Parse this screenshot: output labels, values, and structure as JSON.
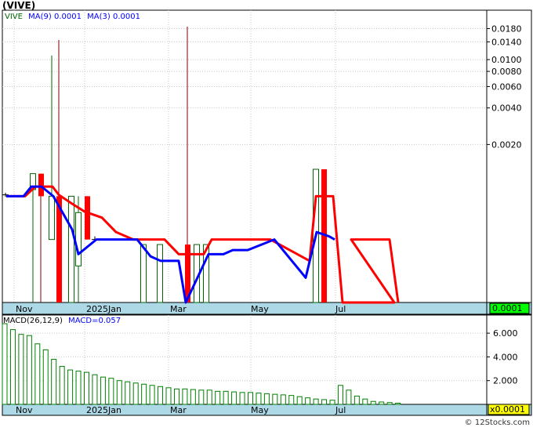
{
  "ticker_label": "(VIVE)",
  "watermark": "© 12Stocks.com",
  "chart_data": [
    {
      "type": "candlestick",
      "name": "price",
      "legend": {
        "symbol": "VIVE",
        "ma9_label": "MA(9)",
        "ma9_value": "0.0001",
        "ma3_label": "MA(3)",
        "ma3_value": "0.0001"
      },
      "scale": "log",
      "ylim": [
        0.0001,
        0.022
      ],
      "y_ticks": [
        "0.0180",
        "0.0140",
        "0.0100",
        "0.0080",
        "0.0060",
        "0.0040",
        "0.0020"
      ],
      "y_tick_values": [
        0.018,
        0.014,
        0.01,
        0.008,
        0.006,
        0.004,
        0.002
      ],
      "x_labels": [
        "Nov",
        "2025Jan",
        "Mar",
        "May",
        "Jul"
      ],
      "last_price_label": "0.0001",
      "colors": {
        "up": "#006400",
        "down": "#ff0000",
        "wick_down": "#800000",
        "ma9": "#0000ff",
        "ma3": "#ff0000",
        "axis_bg": "#add8e6",
        "last_bg": "#00ff00"
      },
      "candles": [
        {
          "x": 7,
          "o": 0.00077,
          "c": 0.00077,
          "h": 0.0008,
          "l": 0.00074,
          "dir": "tick"
        },
        {
          "x": 42,
          "o": 0.00085,
          "c": 0.00115,
          "h": 0.00115,
          "l": 0.0001,
          "dir": "up"
        },
        {
          "x": 52,
          "o": 0.00115,
          "c": 0.00075,
          "h": 0.00115,
          "l": 0.0001,
          "dir": "down"
        },
        {
          "x": 66,
          "o": 0.00033,
          "c": 0.00075,
          "h": 0.0108,
          "l": 0.00033,
          "dir": "up"
        },
        {
          "x": 75,
          "o": 0.00075,
          "c": 0.0001,
          "h": 0.0145,
          "l": 0.0001,
          "dir": "down"
        },
        {
          "x": 91,
          "o": 0.0001,
          "c": 0.00075,
          "h": 0.00075,
          "l": 0.0001,
          "dir": "up"
        },
        {
          "x": 100,
          "o": 0.0002,
          "c": 0.00055,
          "h": 0.00075,
          "l": 0.0001,
          "dir": "up"
        },
        {
          "x": 111,
          "o": 0.00075,
          "c": 0.00033,
          "h": 0.00075,
          "l": 0.00033,
          "dir": "down"
        },
        {
          "x": 121,
          "o": 0.00033,
          "c": 0.00033,
          "h": 0.00035,
          "l": 0.00032,
          "dir": "tick"
        },
        {
          "x": 183,
          "o": 0.0001,
          "c": 0.0003,
          "h": 0.0003,
          "l": 0.0001,
          "dir": "up"
        },
        {
          "x": 204,
          "o": 0.0001,
          "c": 0.0003,
          "h": 0.0003,
          "l": 0.0001,
          "dir": "up"
        },
        {
          "x": 239,
          "o": 0.0003,
          "c": 0.0001,
          "h": 0.0187,
          "l": 0.0001,
          "dir": "down"
        },
        {
          "x": 251,
          "o": 0.0001,
          "c": 0.0003,
          "h": 0.0003,
          "l": 0.0001,
          "dir": "up"
        },
        {
          "x": 263,
          "o": 0.0001,
          "c": 0.0003,
          "h": 0.0003,
          "l": 0.0001,
          "dir": "up"
        },
        {
          "x": 403,
          "o": 0.0001,
          "c": 0.00125,
          "h": 0.00125,
          "l": 0.0001,
          "dir": "up"
        },
        {
          "x": 413,
          "o": 0.00125,
          "c": 0.0001,
          "h": 0.00125,
          "l": 0.0001,
          "dir": "down"
        }
      ],
      "ma9": [
        [
          8,
          0.00075
        ],
        [
          30,
          0.00075
        ],
        [
          40,
          0.0009
        ],
        [
          53,
          0.0009
        ],
        [
          68,
          0.00075
        ],
        [
          92,
          0.0004
        ],
        [
          100,
          0.00025
        ],
        [
          123,
          0.00033
        ],
        [
          175,
          0.00033
        ],
        [
          192,
          0.00024
        ],
        [
          205,
          0.00022
        ],
        [
          228,
          0.00022
        ],
        [
          237,
          0.0001
        ],
        [
          266,
          0.00025
        ],
        [
          285,
          0.00025
        ],
        [
          297,
          0.00027
        ],
        [
          316,
          0.00027
        ],
        [
          350,
          0.00033
        ],
        [
          390,
          0.00016
        ],
        [
          404,
          0.00038
        ],
        [
          420,
          0.00035
        ],
        [
          427,
          0.00033
        ]
      ],
      "ma3": [
        [
          8,
          0.00075
        ],
        [
          32,
          0.00075
        ],
        [
          45,
          0.0009
        ],
        [
          67,
          0.0009
        ],
        [
          75,
          0.00077
        ],
        [
          92,
          0.00065
        ],
        [
          108,
          0.00056
        ],
        [
          130,
          0.0005
        ],
        [
          148,
          0.00038
        ],
        [
          170,
          0.00033
        ],
        [
          210,
          0.00033
        ],
        [
          228,
          0.00025
        ],
        [
          260,
          0.00025
        ],
        [
          270,
          0.00033
        ],
        [
          345,
          0.00033
        ],
        [
          395,
          0.00022
        ],
        [
          403,
          0.00075
        ],
        [
          425,
          0.00075
        ],
        [
          437,
          0.0001
        ],
        [
          503,
          0.0001
        ],
        [
          448,
          0.00033
        ],
        [
          497,
          0.00033
        ],
        [
          508,
          0.0001
        ]
      ]
    },
    {
      "type": "bar",
      "name": "macd",
      "legend": {
        "label": "MACD(26,12,9)",
        "value_label": "MACD=0.057"
      },
      "ylim": [
        0,
        7.0
      ],
      "y_ticks": [
        "6.000",
        "4.000",
        "2.000"
      ],
      "y_tick_values": [
        6.0,
        4.0,
        2.0
      ],
      "x_labels": [
        "Nov",
        "2025Jan",
        "Mar",
        "May",
        "Jul"
      ],
      "last_label": "x0.0001",
      "colors": {
        "bar": "#008000",
        "axis_bg": "#add8e6",
        "last_bg": "#ffff00"
      },
      "values": [
        6.8,
        6.3,
        5.9,
        5.8,
        5.1,
        4.6,
        3.8,
        3.2,
        2.9,
        2.8,
        2.7,
        2.5,
        2.3,
        2.2,
        2.0,
        1.9,
        1.8,
        1.7,
        1.6,
        1.5,
        1.4,
        1.3,
        1.3,
        1.25,
        1.2,
        1.2,
        1.1,
        1.1,
        1.05,
        1.0,
        1.0,
        0.95,
        0.9,
        0.85,
        0.8,
        0.75,
        0.65,
        0.55,
        0.45,
        0.4,
        0.35,
        1.6,
        1.2,
        0.7,
        0.45,
        0.25,
        0.2,
        0.15,
        0.1
      ]
    }
  ]
}
